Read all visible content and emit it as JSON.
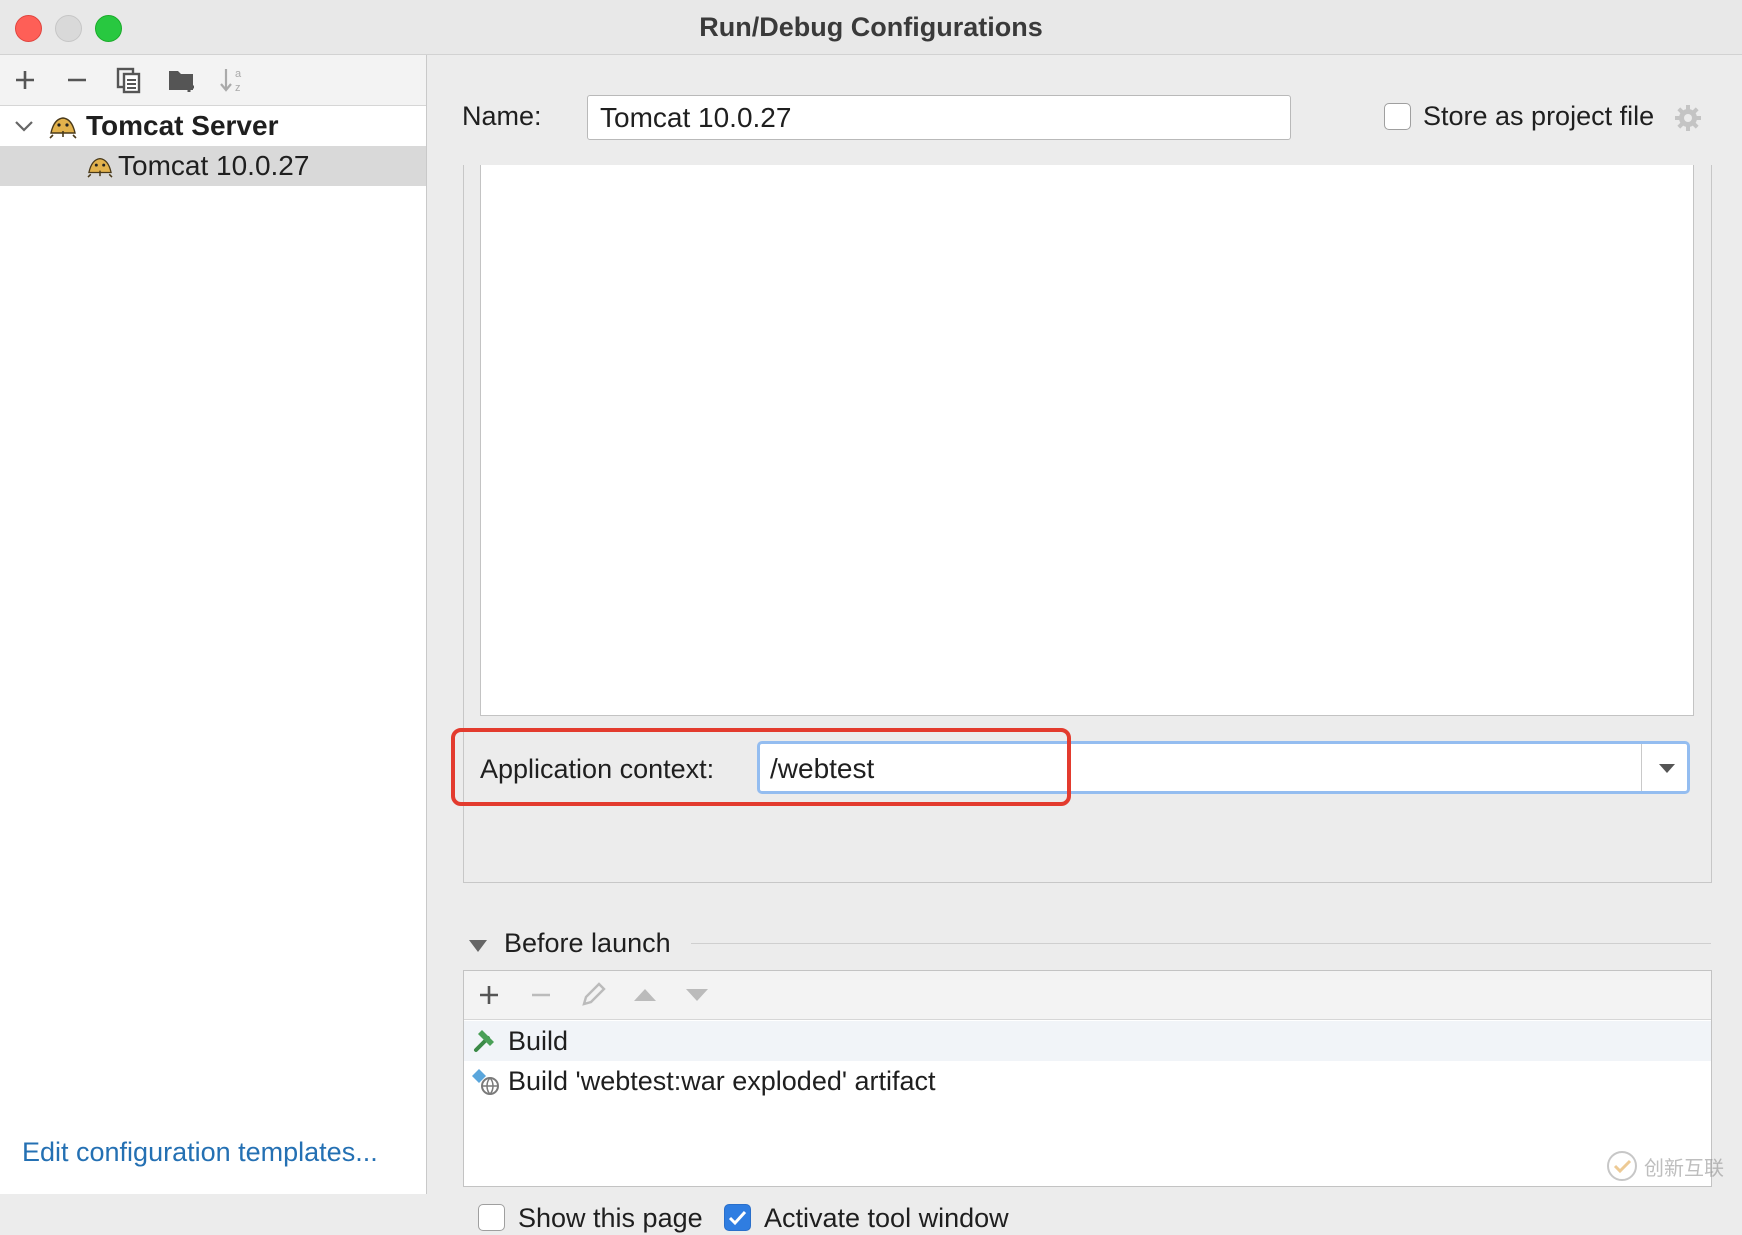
{
  "window": {
    "title": "Run/Debug Configurations"
  },
  "toolbar": {
    "icons": [
      "add-icon",
      "remove-icon",
      "copy-icon",
      "new-folder-icon",
      "sort-icon"
    ]
  },
  "tree": {
    "group_label": "Tomcat Server",
    "item_label": "Tomcat 10.0.27"
  },
  "edit_templates_link": "Edit configuration templates...",
  "form": {
    "name_label": "Name:",
    "name_value": "Tomcat 10.0.27",
    "store_as_project_label": "Store as project file",
    "store_as_project_checked": false,
    "app_context_label": "Application context:",
    "app_context_value": "/webtest"
  },
  "before_launch": {
    "label": "Before launch",
    "toolbar_icons": [
      "add-icon",
      "remove-icon",
      "edit-icon",
      "move-up-icon",
      "move-down-icon"
    ],
    "items": [
      {
        "label": "Build",
        "icon": "hammer-icon"
      },
      {
        "label": "Build 'webtest:war exploded' artifact",
        "icon": "artifact-icon"
      }
    ]
  },
  "footer": {
    "show_page_label": "Show this page",
    "show_page_checked": false,
    "activate_tool_label": "Activate tool window",
    "activate_tool_checked": true
  },
  "colors": {
    "accent": "#2f7de1",
    "highlight": "#e33b2e",
    "link": "#2470b3"
  }
}
